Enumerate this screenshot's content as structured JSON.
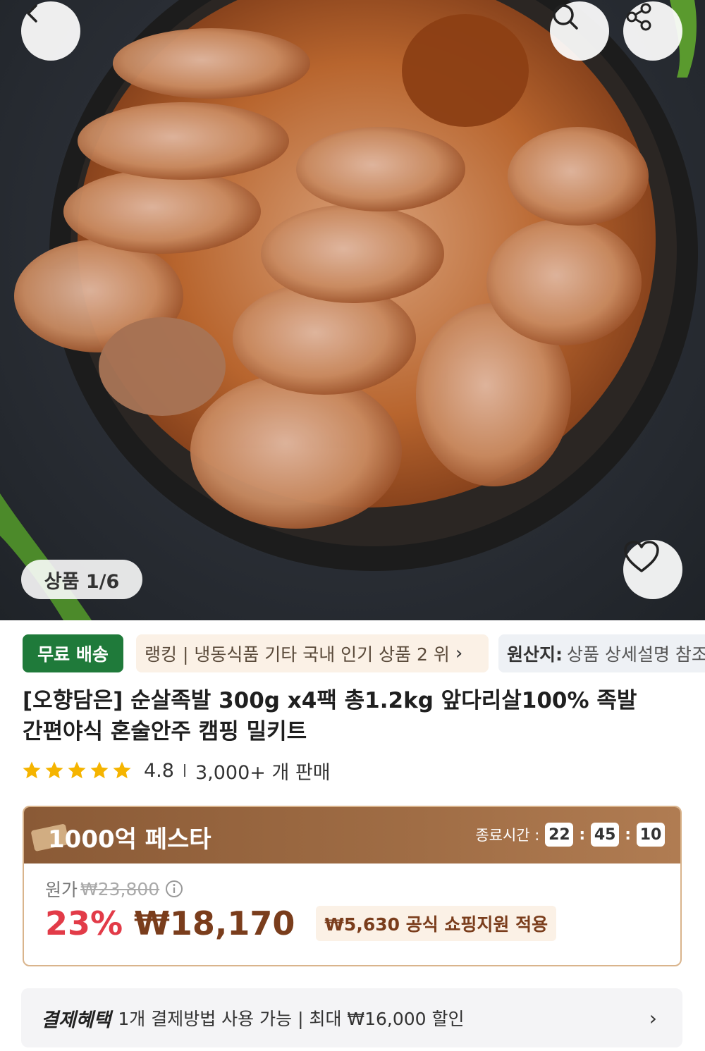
{
  "hero": {
    "back_icon": "chevron-left-icon",
    "search_icon": "search-icon",
    "share_icon": "share-icon",
    "heart_icon": "heart-icon",
    "counter": "상품 1/6"
  },
  "tags": {
    "free_shipping": "무료 배송",
    "ranking": "랭킹 | 냉동식품 기타 국내 인기 상품 2 위",
    "ranking_chevron": "›",
    "origin_label": "원산지:",
    "origin_value": "상품 상세설명 참조"
  },
  "product": {
    "title_line1": "[오향담은] 순살족발 300g x4팩 총1.2kg 앞다리살100% 족발",
    "title_line2": "간편야식 혼술안주 캠핑 밀키트",
    "rating": "4.8",
    "stars": 5,
    "sold": "3,000+ 개 판매"
  },
  "promo": {
    "title": "1000억 페스타",
    "timer_label": "종료시간 :",
    "timer_hours": "22",
    "timer_minutes": "45",
    "timer_seconds": "10",
    "original_label": "원가",
    "original_price": "₩23,800",
    "discount": "23%",
    "price": "₩18,170",
    "support": "₩5,630 공식 쇼핑지원 적용"
  },
  "payment": {
    "title": "결제혜택",
    "text": "1개 결제방법 사용 가능 | 최대 ₩16,000 할인",
    "chevron": "›"
  },
  "colors": {
    "free_shipping_bg": "#1f7a3a",
    "discount": "#e23b48",
    "price": "#7a3d1c",
    "promo_header": "#8a5a36",
    "star": "#f5b400"
  }
}
